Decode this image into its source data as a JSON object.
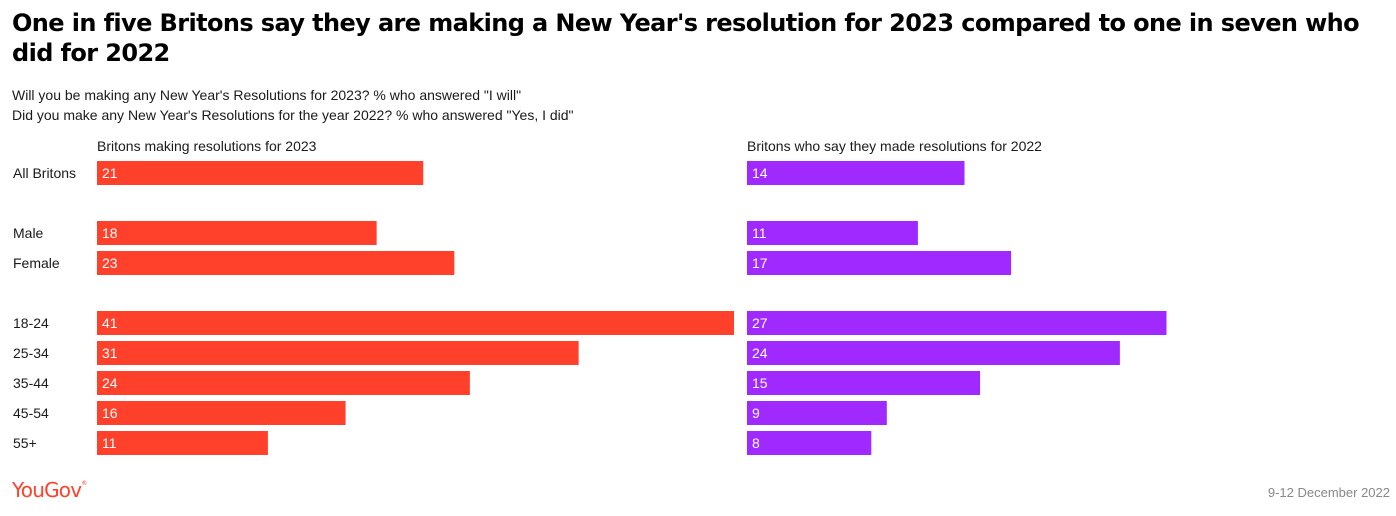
{
  "title": "One in five Britons say they are making a New Year's resolution for 2023 compared to one in seven who did for 2022",
  "subtitle_lines": [
    "Will you be making any New Year's Resolutions for 2023? % who answered \"I will\"",
    "Did you make any New Year's Resolutions for the year 2022? % who answered \"Yes, I did\""
  ],
  "brand": "YouGov",
  "date": "9-12 December 2022",
  "colors": {
    "panel_2023": "#ff412c",
    "panel_2022": "#9f29ff"
  },
  "chart_data": {
    "type": "bar",
    "orientation": "horizontal",
    "categories": [
      "All Britons",
      "Male",
      "Female",
      "18-24",
      "25-34",
      "35-44",
      "45-54",
      "55+"
    ],
    "groups": [
      [
        "All Britons"
      ],
      [
        "Male",
        "Female"
      ],
      [
        "18-24",
        "25-34",
        "35-44",
        "45-54",
        "55+"
      ]
    ],
    "series": [
      {
        "name": "Britons making resolutions for 2023",
        "values": [
          21,
          18,
          23,
          41,
          31,
          24,
          16,
          11
        ],
        "color": "#ff412c"
      },
      {
        "name": "Britons who say they made resolutions for 2022",
        "values": [
          14,
          11,
          17,
          27,
          24,
          15,
          9,
          8
        ],
        "color": "#9f29ff"
      }
    ],
    "xlim": [
      0,
      41
    ],
    "grid": false,
    "data_labels": "inside-left"
  }
}
